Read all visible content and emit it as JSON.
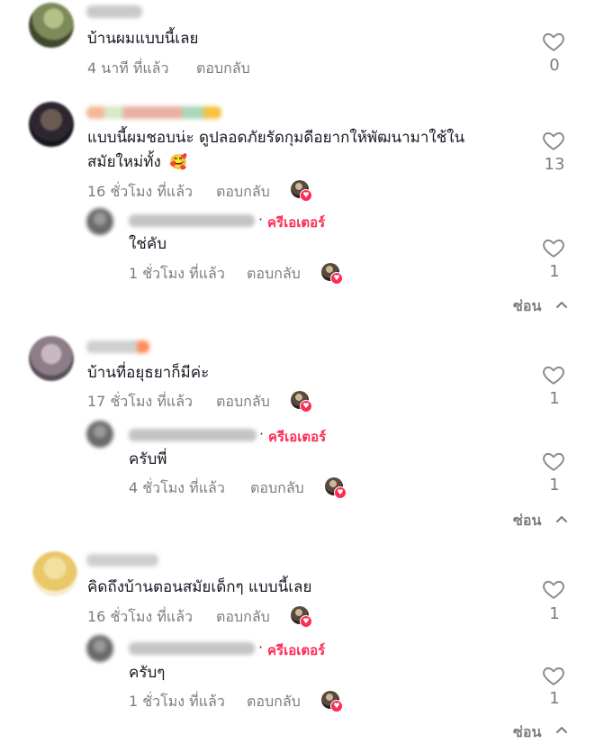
{
  "comments": [
    {
      "text": "บ้านผมแบบนี้เลย",
      "time": "4 นาที ที่แล้ว",
      "reply_label": "ตอบกลับ",
      "likes": "0"
    },
    {
      "text_line1": "แบบนี้ผมชอบน่ะ ดูปลอดภัยรัดกุมดีอยากให้พัฒนามาใช้ใน",
      "text_line2": "สมัยใหม่ทั้ง",
      "emoji": "🥰",
      "time": "16 ชั่วโมง ที่แล้ว",
      "reply_label": "ตอบกลับ",
      "likes": "13",
      "reply": {
        "badge_dot": "·",
        "badge": "ครีเอเตอร์",
        "text": "ใช่คับ",
        "time": "1 ชั่วโมง ที่แล้ว",
        "reply_label": "ตอบกลับ",
        "likes": "1"
      },
      "hide_label": "ซ่อน"
    },
    {
      "text": "บ้านที่อยุธยาก็มีค่ะ",
      "time": "17 ชั่วโมง ที่แล้ว",
      "reply_label": "ตอบกลับ",
      "likes": "1",
      "reply": {
        "badge_dot": "·",
        "badge": "ครีเอเตอร์",
        "text": "ครับพี่",
        "time": "4 ชั่วโมง ที่แล้ว",
        "reply_label": "ตอบกลับ",
        "likes": "1"
      },
      "hide_label": "ซ่อน"
    },
    {
      "text": "คิดถึงบ้านตอนสมัยเด็กๆ แบบนี้เลย",
      "time": "16 ชั่วโมง ที่แล้ว",
      "reply_label": "ตอบกลับ",
      "likes": "1",
      "reply": {
        "badge_dot": "·",
        "badge": "ครีเอเตอร์",
        "text": "ครับๆ",
        "time": "1 ชั่วโมง ที่แล้ว",
        "reply_label": "ตอบกลับ",
        "likes": "1"
      },
      "hide_label": "ซ่อน"
    }
  ],
  "icons": {
    "like": "heart-outline-icon",
    "creator_liked": "creator-liked-heart-icon",
    "collapse": "chevron-up-icon"
  },
  "colors": {
    "text": "#161823",
    "meta": "#7b7c82",
    "creator": "#fe2c55",
    "icon_stroke": "#8a8b91"
  }
}
